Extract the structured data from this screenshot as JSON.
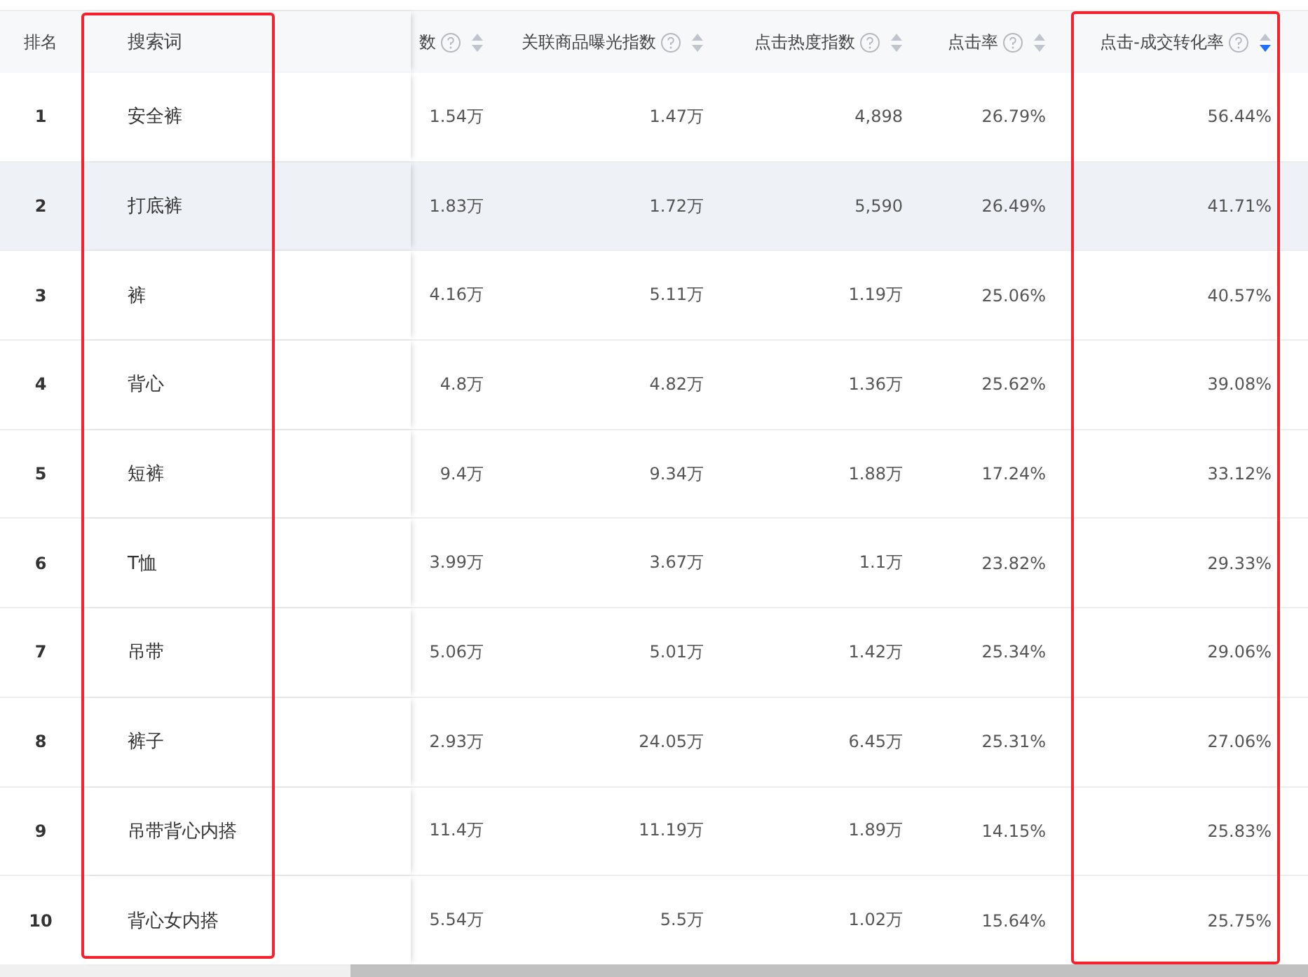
{
  "table": {
    "columns": [
      {
        "label": "排名",
        "help": false,
        "sortable": false,
        "highlighted": false
      },
      {
        "label": "搜索词",
        "help": false,
        "sortable": false,
        "highlighted": true
      },
      {
        "label": "数",
        "help": true,
        "sortable": true,
        "sorted_desc": false,
        "highlighted": false
      },
      {
        "label": "关联商品曝光指数",
        "help": true,
        "sortable": true,
        "sorted_desc": false,
        "highlighted": false
      },
      {
        "label": "点击热度指数",
        "help": true,
        "sortable": true,
        "sorted_desc": false,
        "highlighted": false
      },
      {
        "label": "点击率",
        "help": true,
        "sortable": true,
        "sorted_desc": false,
        "highlighted": false
      },
      {
        "label": "点击-成交转化率",
        "help": true,
        "sortable": true,
        "sorted_desc": true,
        "highlighted": true
      }
    ],
    "rows": [
      {
        "hovered": false,
        "cells": [
          "1",
          "安全裤",
          "1.54万",
          "1.47万",
          "4,898",
          "26.79%",
          "56.44%"
        ]
      },
      {
        "hovered": true,
        "cells": [
          "2",
          "打底裤",
          "1.83万",
          "1.72万",
          "5,590",
          "26.49%",
          "41.71%"
        ]
      },
      {
        "hovered": false,
        "cells": [
          "3",
          "裤",
          "4.16万",
          "5.11万",
          "1.19万",
          "25.06%",
          "40.57%"
        ]
      },
      {
        "hovered": false,
        "cells": [
          "4",
          "背心",
          "4.8万",
          "4.82万",
          "1.36万",
          "25.62%",
          "39.08%"
        ]
      },
      {
        "hovered": false,
        "cells": [
          "5",
          "短裤",
          "9.4万",
          "9.34万",
          "1.88万",
          "17.24%",
          "33.12%"
        ]
      },
      {
        "hovered": false,
        "cells": [
          "6",
          "T恤",
          "3.99万",
          "3.67万",
          "1.1万",
          "23.82%",
          "29.33%"
        ]
      },
      {
        "hovered": false,
        "cells": [
          "7",
          "吊带",
          "5.06万",
          "5.01万",
          "1.42万",
          "25.34%",
          "29.06%"
        ]
      },
      {
        "hovered": false,
        "cells": [
          "8",
          "裤子",
          "2.93万",
          "24.05万",
          "6.45万",
          "25.31%",
          "27.06%"
        ]
      },
      {
        "hovered": false,
        "cells": [
          "9",
          "吊带背心内搭",
          "11.4万",
          "11.19万",
          "1.89万",
          "14.15%",
          "25.83%"
        ]
      },
      {
        "hovered": false,
        "cells": [
          "10",
          "背心女内搭",
          "5.54万",
          "5.5万",
          "1.02万",
          "15.64%",
          "25.75%"
        ]
      }
    ]
  }
}
